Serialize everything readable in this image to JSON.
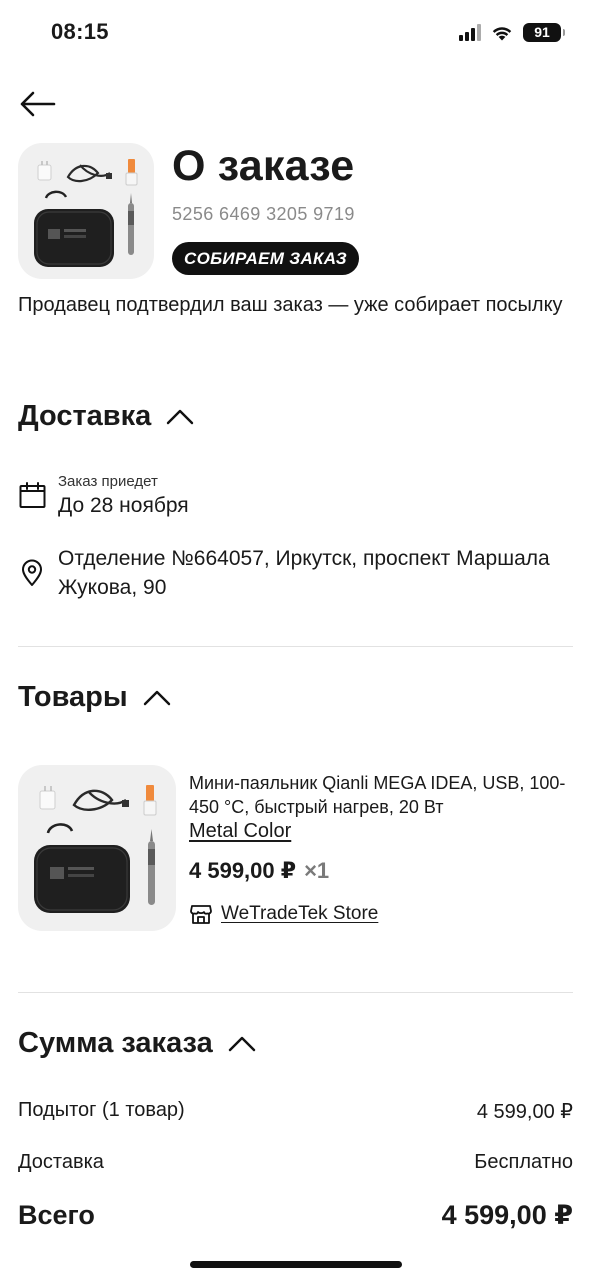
{
  "status_bar": {
    "time": "08:15",
    "battery": "91"
  },
  "header": {
    "title": "О заказе",
    "order_number": "5256 6469 3205 9719",
    "status_badge": "СОБИРАЕМ ЗАКАЗ",
    "status_message": "Продавец подтвердил ваш заказ — уже собирает посылку"
  },
  "delivery": {
    "title": "Доставка",
    "eta_label": "Заказ приедет",
    "eta_value": "До 28 ноября",
    "address": "Отделение №664057, Иркутск, проспект Маршала Жукова, 90"
  },
  "goods": {
    "title": "Товары",
    "items": [
      {
        "name": "Мини-паяльник Qianli MEGA IDEA, USB, 100-450 °C, быстрый нагрев, 20 Вт",
        "variant": "Metal Color",
        "price": "4 599,00 ₽",
        "qty": "×1",
        "store": "WeTradeTek Store"
      }
    ]
  },
  "summary": {
    "title": "Сумма заказа",
    "subtotal_label": "Подытог (1 товар)",
    "subtotal_value": "4 599,00 ₽",
    "delivery_label": "Доставка",
    "delivery_value": "Бесплатно",
    "total_label": "Всего",
    "total_value": "4 599,00 ₽"
  },
  "icons": {
    "back": "arrow-left-icon",
    "collapse": "chevron-up-icon",
    "calendar": "calendar-icon",
    "location": "location-pin-icon",
    "store": "store-icon"
  },
  "colors": {
    "badge_bg": "#111111",
    "muted": "#8a8a8a",
    "divider": "#e2e2e2",
    "thumb_bg": "#f0f0f0"
  }
}
